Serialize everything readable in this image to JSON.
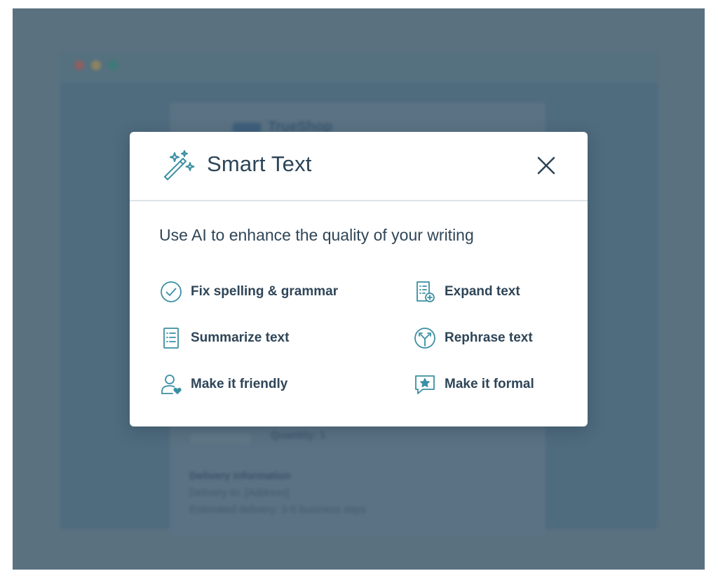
{
  "background": {
    "brand": "TrueShop",
    "delivery_heading": "Delivery information",
    "delivery_to": "Delivery to: [Address]",
    "delivery_estimate": "Estimated delivery: 3-5 business days",
    "badge": "Quantity: 1"
  },
  "modal": {
    "title": "Smart Text",
    "subtitle": "Use AI to enhance the quality of your writing",
    "options": [
      {
        "label": "Fix spelling & grammar",
        "icon": "check-circle-icon"
      },
      {
        "label": "Expand text",
        "icon": "document-plus-icon"
      },
      {
        "label": "Summarize text",
        "icon": "list-document-icon"
      },
      {
        "label": "Rephrase text",
        "icon": "diverge-arrows-icon"
      },
      {
        "label": "Make it friendly",
        "icon": "user-heart-icon"
      },
      {
        "label": "Make it formal",
        "icon": "star-speech-bubble-icon"
      }
    ]
  },
  "colors": {
    "accent": "#3a8fa3",
    "text": "#2e4558",
    "overlay": "#5a7180"
  }
}
